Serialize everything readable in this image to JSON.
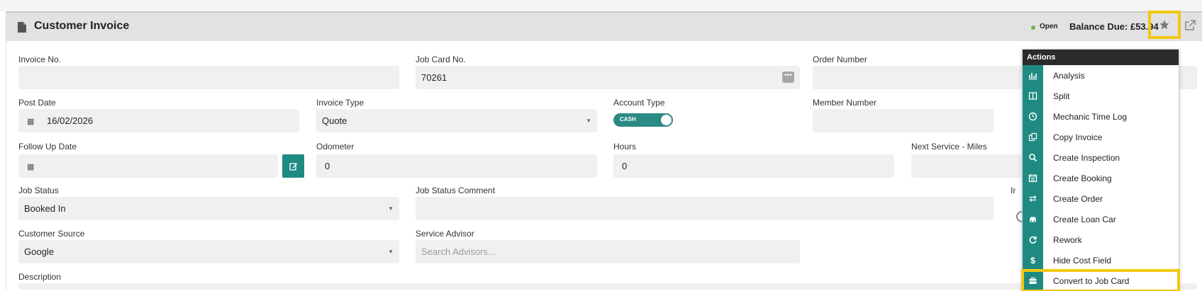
{
  "header": {
    "title": "Customer Invoice",
    "status": "Open",
    "balance": "Balance Due: £53.94"
  },
  "form": {
    "invoice_no": {
      "label": "Invoice No.",
      "value": ""
    },
    "job_card_no": {
      "label": "Job Card No.",
      "value": "70261"
    },
    "order_number": {
      "label": "Order Number",
      "value": ""
    },
    "post_date": {
      "label": "Post Date",
      "value": "16/02/2026"
    },
    "invoice_type": {
      "label": "Invoice Type",
      "value": "Quote"
    },
    "account_type": {
      "label": "Account Type",
      "value": "CASH"
    },
    "member_number": {
      "label": "Member Number",
      "value": ""
    },
    "follow_up_date": {
      "label": "Follow Up Date",
      "value": ""
    },
    "odometer": {
      "label": "Odometer",
      "value": "0"
    },
    "hours": {
      "label": "Hours",
      "value": "0"
    },
    "next_service_miles": {
      "label": "Next Service - Miles",
      "value": ""
    },
    "job_status": {
      "label": "Job Status",
      "value": "Booked In"
    },
    "job_status_comment": {
      "label": "Job Status Comment",
      "value": ""
    },
    "side_label_fragment": "Ir",
    "customer_source": {
      "label": "Customer Source",
      "value": "Google"
    },
    "service_advisor": {
      "label": "Service Advisor",
      "placeholder": "Search Advisors..."
    },
    "description": {
      "label": "Description"
    }
  },
  "menu": {
    "title": "Actions",
    "items": [
      {
        "label": "Analysis",
        "icon": "bar-chart-icon"
      },
      {
        "label": "Split",
        "icon": "columns-icon"
      },
      {
        "label": "Mechanic Time Log",
        "icon": "clock-icon"
      },
      {
        "label": "Copy Invoice",
        "icon": "copy-icon"
      },
      {
        "label": "Create Inspection",
        "icon": "search-icon"
      },
      {
        "label": "Create Booking",
        "icon": "calendar-icon"
      },
      {
        "label": "Create Order",
        "icon": "exchange-icon"
      },
      {
        "label": "Create Loan Car",
        "icon": "car-icon"
      },
      {
        "label": "Rework",
        "icon": "refresh-icon"
      },
      {
        "label": "Hide Cost Field",
        "icon": "dollar-icon"
      },
      {
        "label": "Convert to Job Card",
        "icon": "briefcase-icon"
      }
    ]
  },
  "colors": {
    "accent": "#1f8a82",
    "highlight": "#f2c811",
    "status_open": "#66b84a"
  }
}
